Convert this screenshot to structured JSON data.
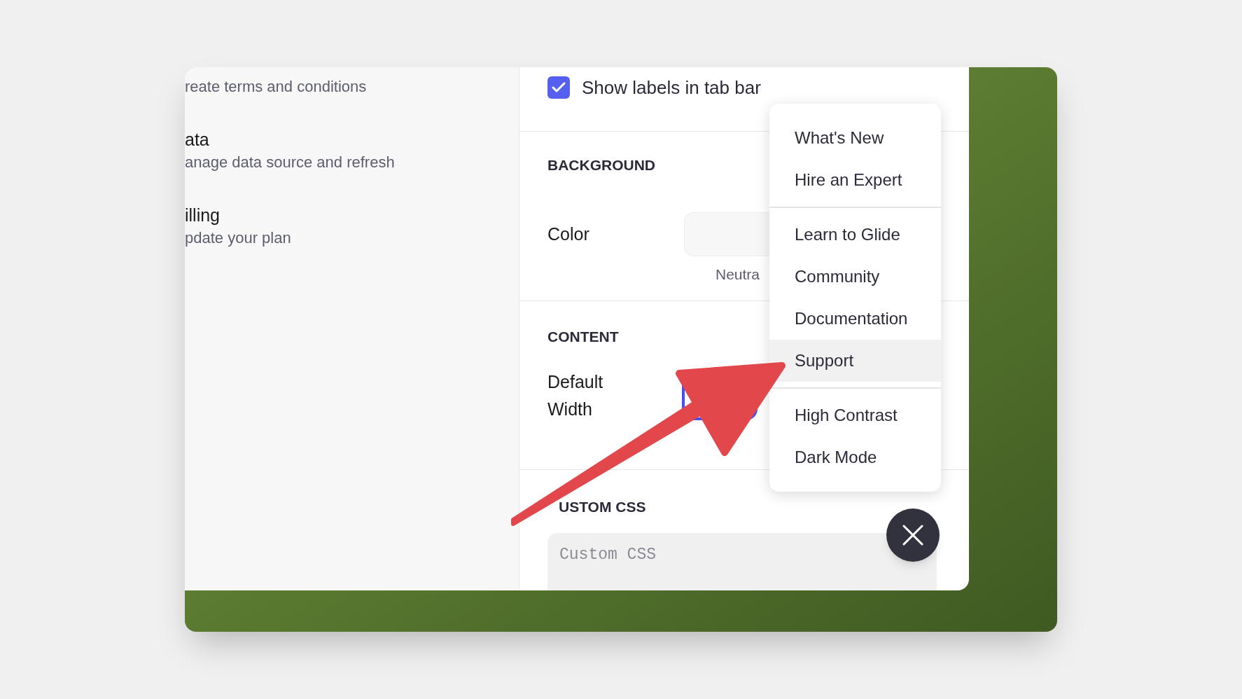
{
  "sidebar": {
    "items": [
      {
        "description": "reate terms and conditions"
      },
      {
        "title": "ata",
        "description": "anage data source and refresh"
      },
      {
        "title": "illing",
        "description": "pdate your plan"
      }
    ]
  },
  "settings": {
    "checkbox": {
      "label": "Show labels in tab bar",
      "checked": true
    },
    "background": {
      "heading": "BACKGROUND",
      "label": "Color",
      "caption": "Neutra"
    },
    "content": {
      "heading": "CONTENT",
      "label": "Default Width"
    },
    "custom_css": {
      "heading": "USTOM CSS",
      "placeholder": "Custom CSS"
    }
  },
  "menu": {
    "groups": [
      [
        {
          "label": "What's New",
          "selected": false
        },
        {
          "label": "Hire an Expert",
          "selected": false
        }
      ],
      [
        {
          "label": "Learn to Glide",
          "selected": false
        },
        {
          "label": "Community",
          "selected": false
        },
        {
          "label": "Documentation",
          "selected": false
        },
        {
          "label": "Support",
          "selected": true
        }
      ],
      [
        {
          "label": "High Contrast",
          "selected": false
        },
        {
          "label": "Dark Mode",
          "selected": false
        }
      ]
    ]
  }
}
